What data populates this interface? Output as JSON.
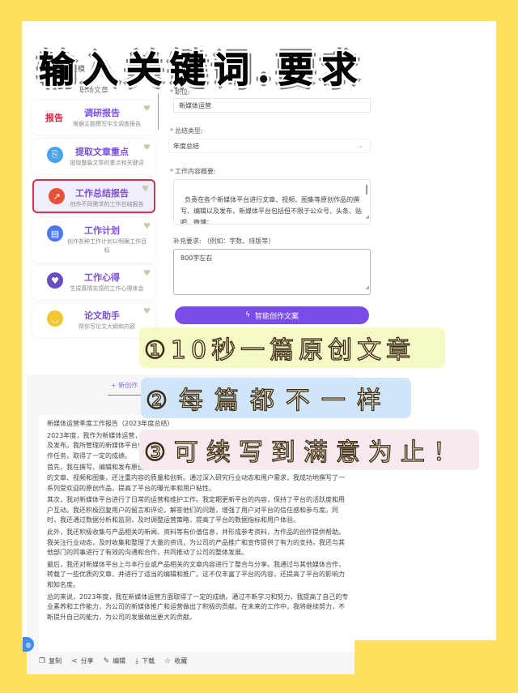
{
  "headline": "输入关键词.要求",
  "sidebar": {
    "header": "场景模",
    "subheader": "职场文章",
    "items": [
      {
        "icon": "report-text-icon",
        "icon_glyph": "报告",
        "title": "调研报告",
        "desc": "根据主题撰写中文调查报告",
        "color": "#d2263f"
      },
      {
        "icon": "document-icon",
        "icon_glyph": "⎘",
        "title": "提取文章重点",
        "desc": "提取整篇文章的重点和关键词",
        "color": "#4aa3e8"
      },
      {
        "icon": "trend-chart-icon",
        "icon_glyph": "↗",
        "title": "工作总结报告",
        "desc": "创作不同需求的工作总结报告",
        "color": "#e8503a",
        "active": true
      },
      {
        "icon": "plan-icon",
        "icon_glyph": "▤",
        "title": "工作计划",
        "desc": "创作各种工作计划以明确工作目标",
        "color": "#4a78e8"
      },
      {
        "icon": "heart-chat-icon",
        "icon_glyph": "♥",
        "title": "工作心得",
        "desc": "生成真情实感的工作心得体会",
        "color": "#6a4ec0"
      },
      {
        "icon": "thesis-icon",
        "icon_glyph": "◡",
        "title": "论文助手",
        "desc": "帮你写论文大纲和内容",
        "color": "#f2c830"
      }
    ]
  },
  "form": {
    "position_label": "职位:",
    "position_value": "新媒体运营",
    "type_label": "总结类型:",
    "type_value": "年度总结",
    "content_label": "工作内容概要:",
    "content_value": "负责在各个新媒体平台进行文章、视频、图集等原创作品的撰写、编辑以及发布，新媒体平台包括但不限于公众号、头条、贴吧、微博；\n负责对具体的新媒体平台进行日常的运营，维护好平台的良好数",
    "extra_label": "补充要求: （例如：字数、排版等）",
    "extra_value": "800字左右",
    "submit_label": "智能创作文案"
  },
  "banners": [
    "①10秒一篇原创文章",
    "②每篇都不一样",
    "③可续写到满意为止！"
  ],
  "result": {
    "new_tab_label": "+ 新创作",
    "paragraphs": [
      "新媒体运营季度工作报告（2023年度总结）",
      "2023年度，我作为新媒体运营，负责在各个新媒体平台进行文章、视频、图集等原创作品的撰写、编辑以及发布。我所管理的新媒体平台包括但不限于公众号、头条、贴吧、微博等。我积极努力地完成了各项工作任务，取得了一定的成绩。",
      "首先，我在撰写、编辑和发布原创作品方面取得了显著的进展。我不仅按照公司的要求，及时发布了大量的文章、视频和图集，还注重内容的质量和创新。通过深入研究行业动态和用户需求，我成功地撰写了一系列受欢迎的原创作品，提高了平台的曝光率和用户粘性。",
      "其次，我对新媒体平台进行了日常的运营和维护工作。我定期更新平台的内容，保持了平台的活跃度和用户互动。我还积极回复用户的留言和评论，解答他们的问题，增强了用户对平台的信任感和参与度。同时，我还通过数据分析和监测，及时调整运营策略，提高了平台的数据指标和用户体验。",
      "此外，我还积极收集与产品相关的新闻、资料等有价值信息，并形成参考资料，为作品的创作提供帮助。我关注行业动态，及时收集和整理了大量的资讯，为公司的产品推广和宣传提供了有力的支持。我还与其他部门的同事进行了有效的沟通和合作，共同推动了公司的整体发展。",
      "最后，我还对新媒体平台上与本行业或产品相关的文章内容进行了整合与分享。我通过与其他媒体合作，转载了一些优质的文章，并进行了适当的编辑和推广。这不仅丰富了平台的内容，还提高了平台的影响力和知名度。",
      "总的来说，2023年度，我在新媒体运营方面取得了一定的成绩。通过不断学习和努力，我提高了自己的专业素养和工作能力，为公司的新媒体推广和运营做出了积极的贡献。在未来的工作中，我将继续努力，不断提升自己的能力，为公司的发展做出更大的贡献。"
    ],
    "actions": [
      {
        "icon": "copy-icon",
        "glyph": "❐",
        "label": "复制"
      },
      {
        "icon": "share-icon",
        "glyph": "<",
        "label": "分享"
      },
      {
        "icon": "edit-icon",
        "glyph": "✎",
        "label": "编辑"
      },
      {
        "icon": "download-icon",
        "glyph": "⤓",
        "label": "下载"
      },
      {
        "icon": "star-icon",
        "glyph": "☆",
        "label": "收藏"
      }
    ]
  },
  "colors": {
    "background": "#fde05e",
    "accent": "#7a4de8",
    "active_border": "#c43a4e"
  }
}
